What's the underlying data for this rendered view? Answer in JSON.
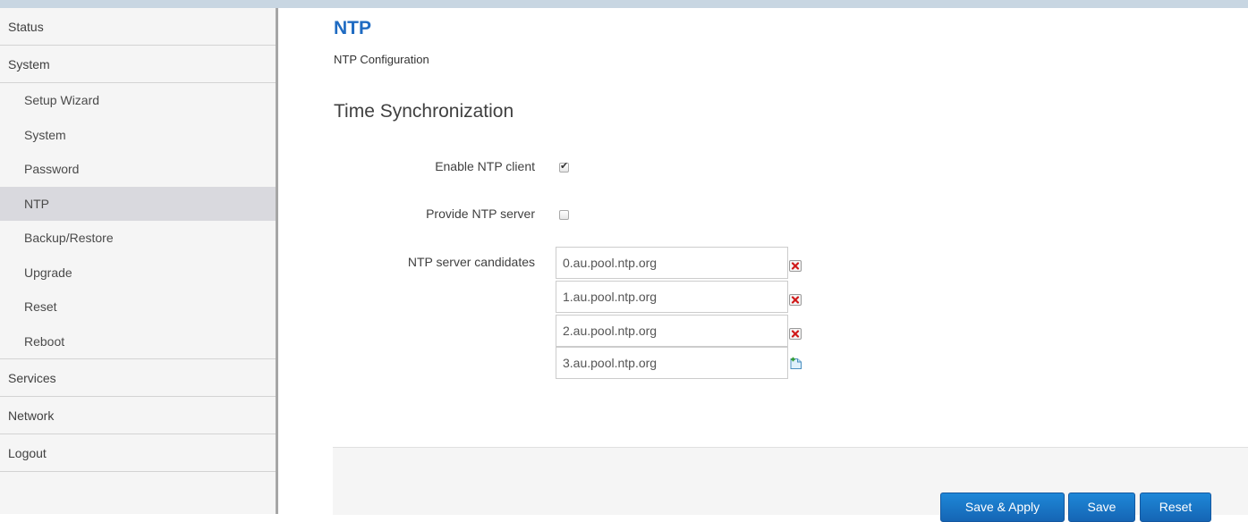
{
  "sidebar": {
    "status": "Status",
    "system": "System",
    "system_items": [
      {
        "label": "Setup Wizard"
      },
      {
        "label": "System"
      },
      {
        "label": "Password"
      },
      {
        "label": "NTP"
      },
      {
        "label": "Backup/Restore"
      },
      {
        "label": "Upgrade"
      },
      {
        "label": "Reset"
      },
      {
        "label": "Reboot"
      }
    ],
    "active_item": "NTP",
    "services": "Services",
    "network": "Network",
    "logout": "Logout"
  },
  "main": {
    "title": "NTP",
    "description": "NTP Configuration",
    "section_title": "Time Synchronization",
    "enable_client_label": "Enable NTP client",
    "enable_client_checked": true,
    "provide_server_label": "Provide NTP server",
    "provide_server_checked": false,
    "candidates_label": "NTP server candidates",
    "candidates": [
      {
        "value": "0.au.pool.ntp.org",
        "action": "remove-icon"
      },
      {
        "value": "1.au.pool.ntp.org",
        "action": "remove-icon"
      },
      {
        "value": "2.au.pool.ntp.org",
        "action": "remove-icon"
      },
      {
        "value": "3.au.pool.ntp.org",
        "action": "add-icon"
      }
    ]
  },
  "footer": {
    "save_apply": "Save & Apply",
    "save": "Save",
    "reset": "Reset"
  },
  "colors": {
    "title": "#1f6bc2",
    "button": "#1a76c8",
    "active_menu": "#d9d9de"
  }
}
